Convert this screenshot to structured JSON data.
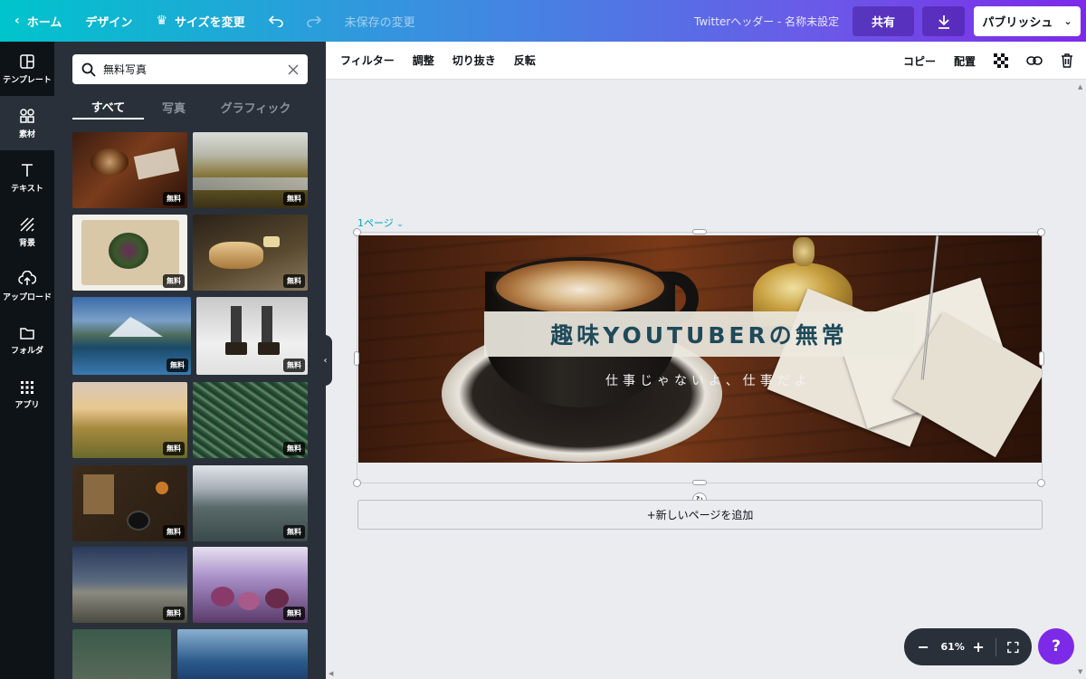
{
  "topbar": {
    "home": "ホーム",
    "design": "デザイン",
    "resize": "サイズを変更",
    "unsaved": "未保存の変更",
    "doc_title": "Twitterヘッダー - 名称未設定",
    "share": "共有",
    "publish": "パブリッシュ"
  },
  "rail": {
    "templates": "テンプレート",
    "elements": "素材",
    "text": "テキスト",
    "background": "背景",
    "upload": "アップロード",
    "folder": "フォルダ",
    "apps": "アプリ"
  },
  "panel": {
    "search_value": "無料写真",
    "tabs": [
      "すべて",
      "写真",
      "グラフィック"
    ],
    "badge": "無料"
  },
  "toolbar": {
    "filter": "フィルター",
    "adjust": "調整",
    "crop": "切り抜き",
    "flip": "反転",
    "copy": "コピー",
    "arrange": "配置"
  },
  "canvas": {
    "page_label": "1ページ",
    "title": "趣味YOUTUBERの無常",
    "subtitle": "仕事じゃないよ、仕事だよ",
    "add_page": "+新しいページを追加"
  },
  "zoom": {
    "level": "61%"
  },
  "help": "?",
  "colors": {
    "accent_purple": "#7d2ae8",
    "accent_teal": "#00c4cc",
    "panel_bg": "#293039",
    "rail_bg": "#0e1318"
  }
}
